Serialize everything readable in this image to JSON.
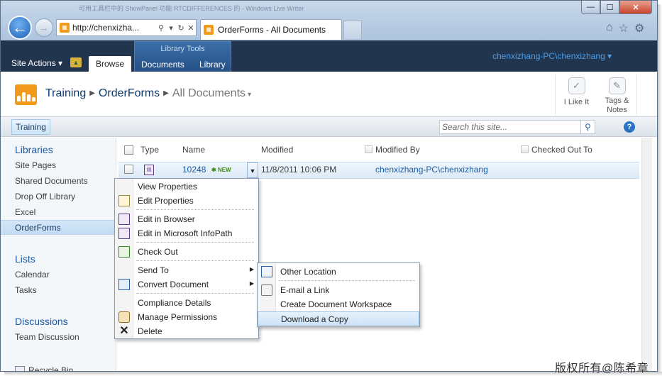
{
  "browser": {
    "window_title": "可用工具栏中的 ShowPanel 功能 RTCDIFFERENCES 的 - Windows Live Writer",
    "address": "http://chenxizha...",
    "tab_title": "OrderForms - All Documents",
    "window_buttons": {
      "minimize": "—",
      "maximize": "☐",
      "close": "✕"
    },
    "address_icons": [
      "search-icon",
      "dropdown-icon",
      "refresh-icon",
      "stop-icon"
    ],
    "toolbar_icons": [
      "home-icon",
      "favorites-icon",
      "tools-icon"
    ]
  },
  "ribbon": {
    "site_actions": "Site Actions",
    "contextual_group": "Library Tools",
    "tabs": [
      "Browse",
      "Documents",
      "Library"
    ],
    "user": "chenxizhang-PC\\chenxizhang",
    "accent": "#21354f"
  },
  "title_area": {
    "breadcrumb": [
      "Training",
      "OrderForms",
      "All Documents"
    ],
    "buttons": [
      {
        "label": "I Like It",
        "icon": "thumbs-up-tag-icon"
      },
      {
        "label": "Tags & Notes",
        "icon": "tag-note-icon"
      }
    ]
  },
  "top_nav": {
    "site": "Training",
    "search_placeholder": "Search this site...",
    "help": "?"
  },
  "quick_launch": {
    "libraries_heading": "Libraries",
    "libraries": [
      "Site Pages",
      "Shared Documents",
      "Drop Off Library",
      "Excel",
      "OrderForms"
    ],
    "selected": "OrderForms",
    "lists_heading": "Lists",
    "lists": [
      "Calendar",
      "Tasks"
    ],
    "discussions_heading": "Discussions",
    "discussions": [
      "Team Discussion"
    ],
    "recycle_bin": "Recycle Bin"
  },
  "list": {
    "columns": [
      "Type",
      "Name",
      "Modified",
      "Modified By",
      "Checked Out To"
    ],
    "rows": [
      {
        "name": "10248",
        "badge": "NEW",
        "modified": "11/8/2011 10:06 PM",
        "modified_by": "chenxizhang-PC\\chenxizhang"
      }
    ]
  },
  "context_menu": {
    "items": [
      "View Properties",
      "Edit Properties",
      "Edit in Browser",
      "Edit in Microsoft InfoPath",
      "Check Out",
      "Send To",
      "Convert Document",
      "Compliance Details",
      "Manage Permissions",
      "Delete"
    ]
  },
  "send_to_menu": {
    "items": [
      "Other Location",
      "E-mail a Link",
      "Create Document Workspace",
      "Download a Copy"
    ],
    "highlighted": "Download a Copy"
  },
  "watermark": "版权所有@陈希章"
}
